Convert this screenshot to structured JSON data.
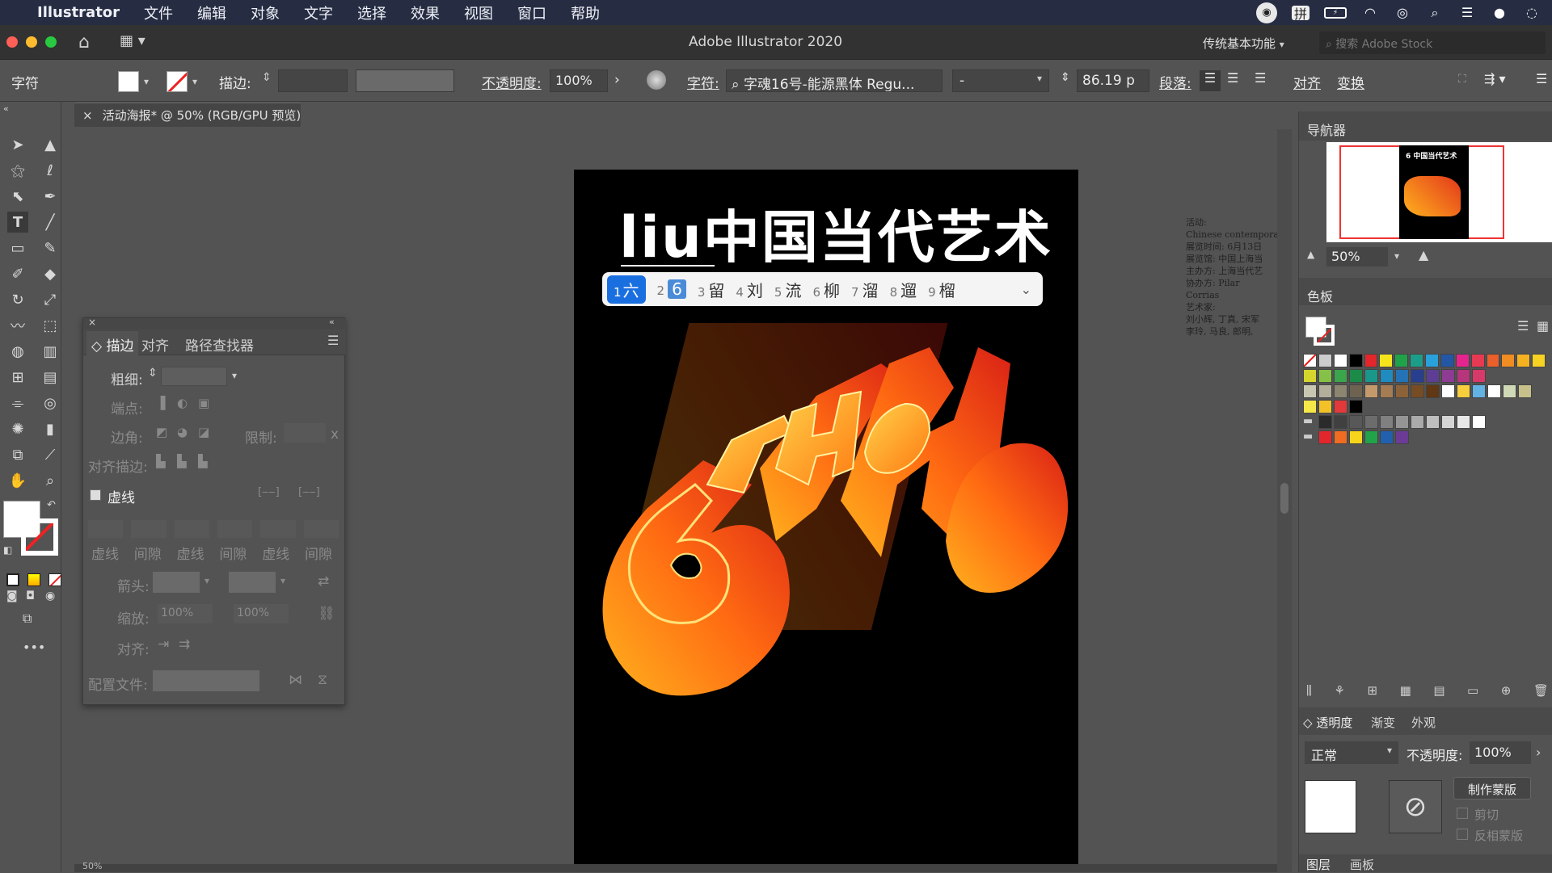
{
  "menubar": {
    "app_name": "Illustrator",
    "items": [
      "文件",
      "编辑",
      "对象",
      "文字",
      "选择",
      "效果",
      "视图",
      "窗口",
      "帮助"
    ],
    "ime_label": "拼"
  },
  "titlebar": {
    "title": "Adobe Illustrator 2020",
    "workspace": "传统基本功能",
    "search_placeholder": "搜索 Adobe Stock"
  },
  "control_bar": {
    "panel_label": "字符",
    "stroke_label": "描边:",
    "opacity_label": "不透明度:",
    "opacity_value": "100%",
    "char_label": "字符:",
    "font_name": "字魂16号-能源黑体 Regu...",
    "font_style": "-",
    "font_size": "86.19 p",
    "paragraph_label": "段落:",
    "align_label": "对齐",
    "transform_label": "变换"
  },
  "document": {
    "tab_label": "活动海报* @ 50% (RGB/GPU 预览)",
    "close_symbol": "×"
  },
  "artboard": {
    "title_text": "liu中国当代艺术",
    "big_text": "6TH",
    "notes": [
      "活动:",
      "Chinese contemporary",
      "展览时间: 6月13日",
      "展览馆: 中国上海当",
      "主办方: 上海当代艺",
      "协办方: Pilar Corrias",
      "艺术家:",
      "刘小辉, 丁真, 宋军",
      "李玲, 马良, 郎明,"
    ]
  },
  "ime": {
    "candidates": [
      {
        "num": "1",
        "text": "六"
      },
      {
        "num": "2",
        "text": "6"
      },
      {
        "num": "3",
        "text": "留"
      },
      {
        "num": "4",
        "text": "刘"
      },
      {
        "num": "5",
        "text": "流"
      },
      {
        "num": "6",
        "text": "柳"
      },
      {
        "num": "7",
        "text": "溜"
      },
      {
        "num": "8",
        "text": "遛"
      },
      {
        "num": "9",
        "text": "榴"
      }
    ]
  },
  "stroke_panel": {
    "tabs": [
      "描边",
      "对齐",
      "路径查找器"
    ],
    "weight_label": "粗细:",
    "cap_label": "端点:",
    "corner_label": "边角:",
    "limit_label": "限制:",
    "limit_unit": "x",
    "align_stroke_label": "对齐描边:",
    "dashed_label": "虚线",
    "dash_labels": [
      "虚线",
      "间隙",
      "虚线",
      "间隙",
      "虚线",
      "间隙"
    ],
    "arrow_label": "箭头:",
    "scale_label": "缩放:",
    "scale_values": [
      "100%",
      "100%"
    ],
    "align_label": "对齐:",
    "profile_label": "配置文件:"
  },
  "navigator": {
    "title": "导航器",
    "zoom": "50%"
  },
  "swatches": {
    "title": "色板",
    "rows": [
      [
        "#ffffff",
        "#cccccc",
        "#ffffff",
        "#000000",
        "#e3262b",
        "#f6e51d",
        "#1fa249",
        "#1b9d89",
        "#29a1db",
        "#2356a4",
        "#e6248d",
        "#e63a53",
        "#ea5f2a",
        "#ef8c22",
        "#f6b121",
        "#f7d223"
      ],
      [
        "#d5d62d",
        "#85c146",
        "#3aa54b",
        "#1c8b48",
        "#19978b",
        "#1f8bbf",
        "#2373b6",
        "#283f8f",
        "#5e3e95",
        "#8e3b93",
        "#b6357d",
        "#d73a6a"
      ],
      [
        "#c9c7b1",
        "#b3ae9a",
        "#8c8570",
        "#6e6350",
        "#c49a6c",
        "#a67c52",
        "#8c6239",
        "#754c24",
        "#603813",
        "#ffffff",
        "#f7ce3b",
        "#62b2e4",
        "#ffffff",
        "#cfd9b6",
        "#c7c08b"
      ],
      [
        "#f7e84a",
        "#f2c128",
        "#e2393a",
        "#000000"
      ],
      [
        "#2b2b2b",
        "#404040",
        "#585858",
        "#6c6c6c",
        "#808080",
        "#959595",
        "#aaaaaa",
        "#bfbfbf",
        "#d4d4d4",
        "#e8e8e8",
        "#ffffff"
      ],
      [
        "#e3262b",
        "#ef6c22",
        "#f6d41b",
        "#22a24a",
        "#2160ad",
        "#6b3b95"
      ]
    ]
  },
  "transparency": {
    "tabs": [
      "透明度",
      "渐变",
      "外观"
    ],
    "blend_mode": "正常",
    "opacity_label": "不透明度:",
    "opacity_value": "100%",
    "make_mask": "制作蒙版",
    "clip_label": "剪切",
    "invert_label": "反相蒙版"
  },
  "bottom_tabs": [
    "图层",
    "画板"
  ],
  "status": {
    "zoom": "50%"
  }
}
